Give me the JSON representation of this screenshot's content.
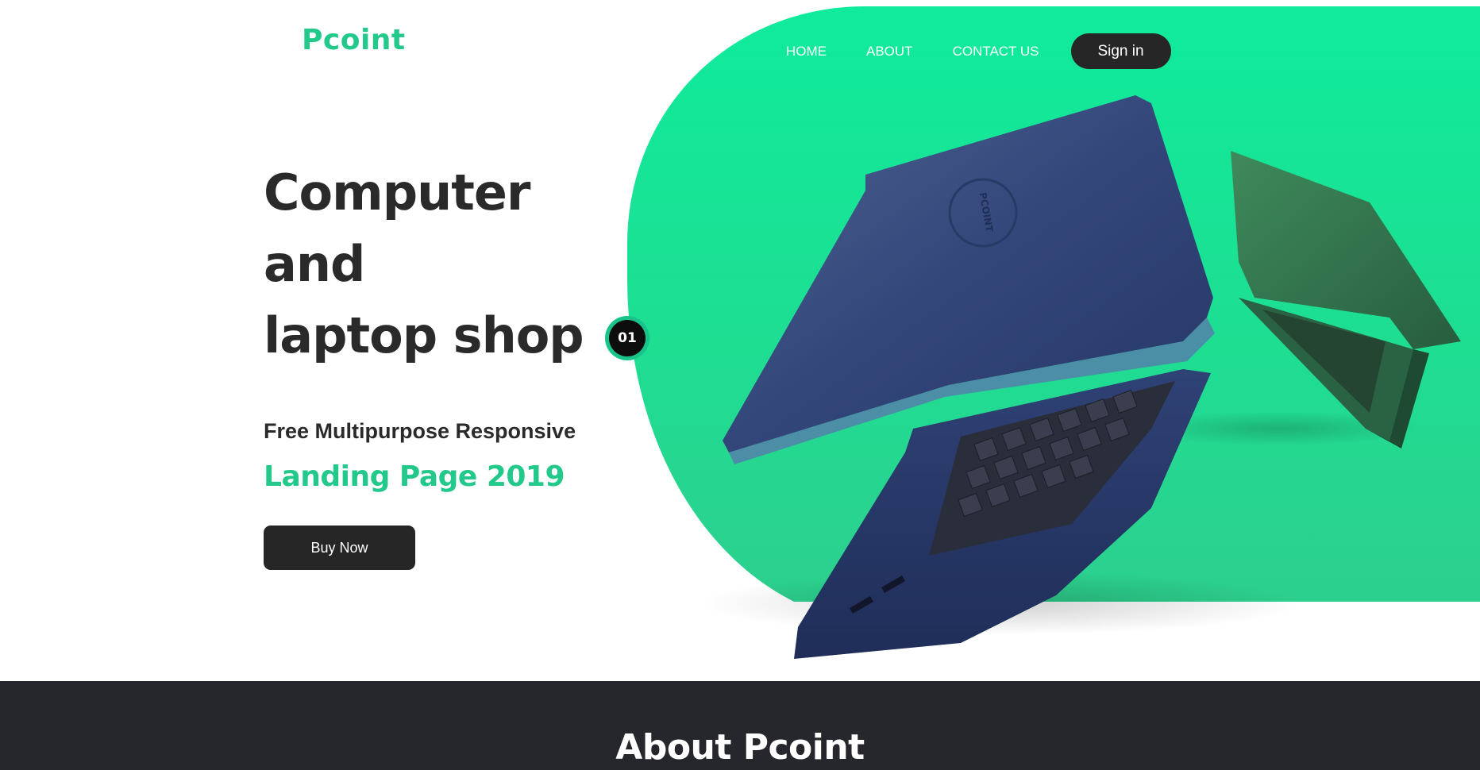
{
  "brand": {
    "logo": "Pcoint"
  },
  "nav": {
    "items": [
      {
        "label": "HOME"
      },
      {
        "label": "ABOUT"
      },
      {
        "label": "CONTACT US"
      }
    ],
    "signin_label": "Sign in"
  },
  "hero": {
    "headline": [
      "Computer",
      "and",
      "laptop shop"
    ],
    "subtitle": "Free Multipurpose Responsive",
    "subtitle_highlight": "Landing Page 2019",
    "cta_label": "Buy Now",
    "slide_number": "01",
    "product_logo_text": "PCOINT"
  },
  "about": {
    "title": "About Pcoint"
  },
  "colors": {
    "accent": "#22c98a",
    "hero_green": "#10e99a",
    "dark": "#262626",
    "footer_bg": "#25272c",
    "laptop_blue": "#2c3d6b",
    "laptop_green": "#2f6e4a"
  },
  "icons": {
    "hero_image": "laptop-product-image"
  }
}
